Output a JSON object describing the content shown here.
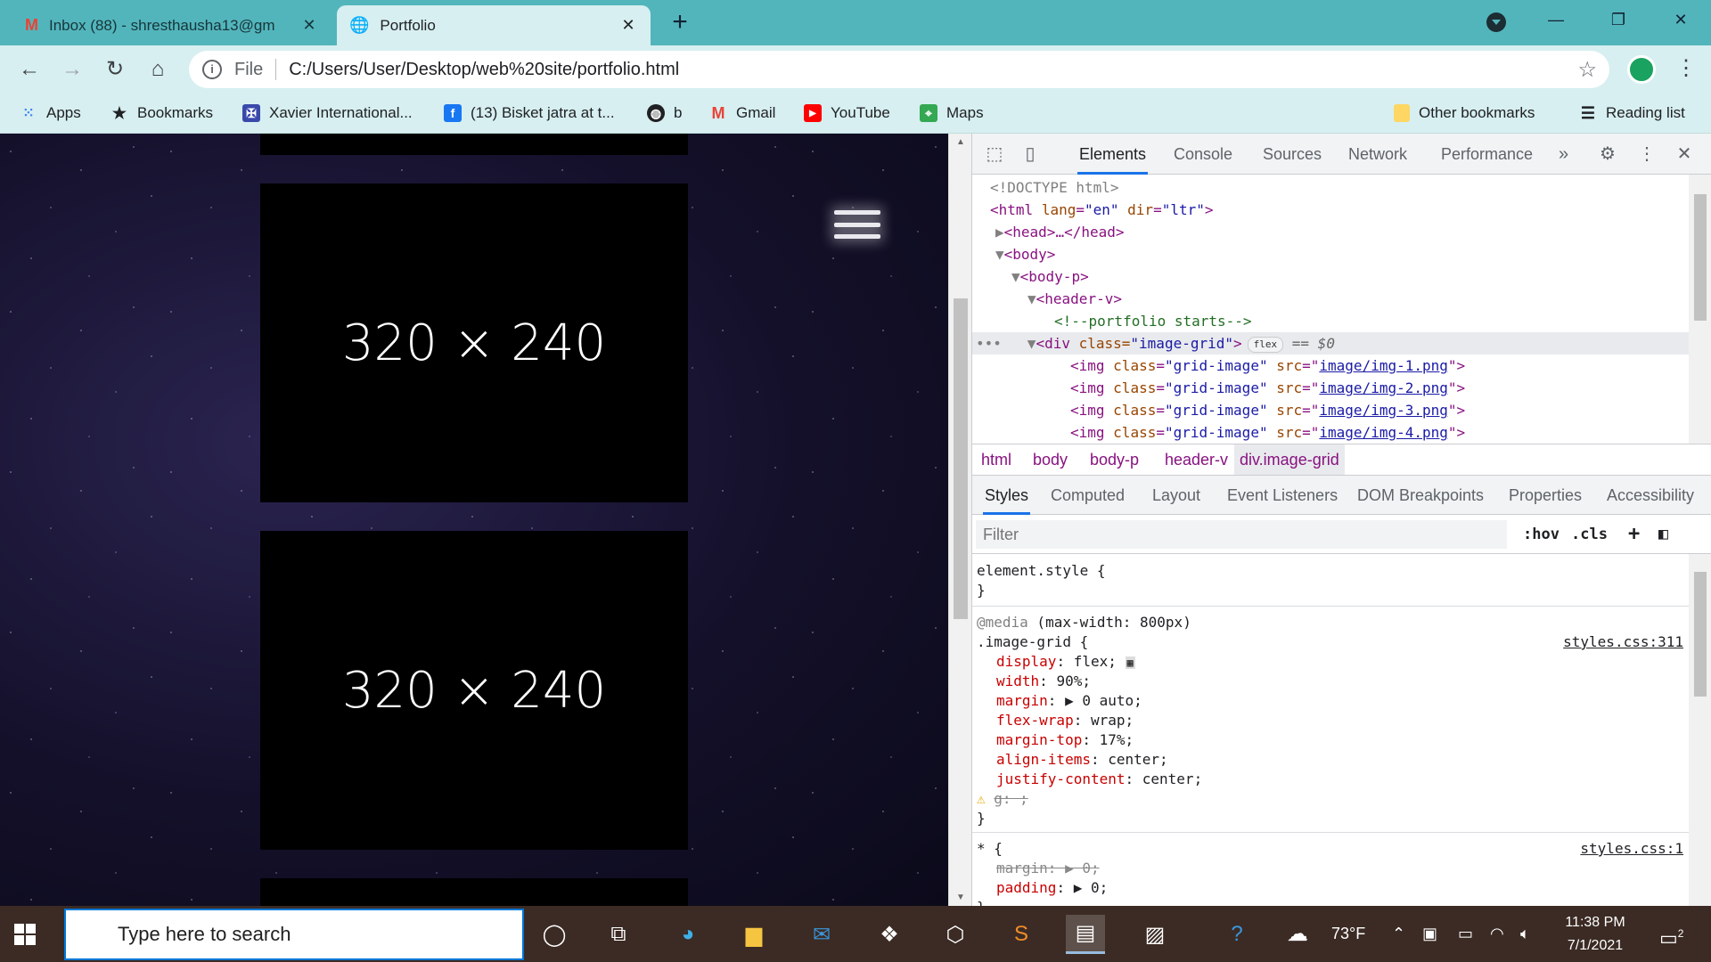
{
  "browser": {
    "tabs": [
      {
        "title": "Inbox (88) - shresthausha13@gm",
        "icon": "gmail-icon",
        "active": false
      },
      {
        "title": "Portfolio",
        "icon": "globe-icon",
        "active": true
      }
    ],
    "url_scheme": "File",
    "url": "C:/Users/User/Desktop/web%20site/portfolio.html"
  },
  "bookmarks": {
    "items": [
      {
        "label": "Apps",
        "icon": "apps-grid-icon"
      },
      {
        "label": "Bookmarks",
        "icon": "star-icon"
      },
      {
        "label": "Xavier International...",
        "icon": "shield-icon"
      },
      {
        "label": "(13) Bisket jatra at t...",
        "icon": "facebook-icon"
      },
      {
        "label": "b",
        "icon": "globe-icon"
      },
      {
        "label": "Gmail",
        "icon": "gmail-icon"
      },
      {
        "label": "YouTube",
        "icon": "youtube-icon"
      },
      {
        "label": "Maps",
        "icon": "maps-icon"
      }
    ],
    "other": "Other bookmarks",
    "reading_list": "Reading list"
  },
  "page": {
    "placeholders": [
      "320 × 240",
      "320 × 240"
    ]
  },
  "devtools": {
    "tabs": [
      "Elements",
      "Console",
      "Sources",
      "Network",
      "Performance"
    ],
    "active_tab": "Elements",
    "more": "»",
    "dom": {
      "doctype": "<!DOCTYPE html>",
      "html_open": "html",
      "html_attrs": [
        {
          "name": "lang",
          "value": "\"en\""
        },
        {
          "name": "dir",
          "value": "\"ltr\""
        }
      ],
      "head": "<head>…</head>",
      "body": "<body>",
      "body_p": "<body-p>",
      "header_v": "<header-v>",
      "comment": "<!--portfolio starts-->",
      "div_open": "<div ",
      "div_class_attr": "class=",
      "div_class_val": "\"image-grid\"",
      "div_close": ">",
      "flex_badge": "flex",
      "dollar": "== $0",
      "imgs": [
        "image/img-1.png",
        "image/img-2.png",
        "image/img-3.png",
        "image/img-4.png"
      ],
      "img_class": "\"grid-image\""
    },
    "breadcrumbs": [
      "html",
      "body",
      "body-p",
      "header-v",
      "div.image-grid"
    ],
    "style_tabs": [
      "Styles",
      "Computed",
      "Layout",
      "Event Listeners",
      "DOM Breakpoints",
      "Properties",
      "Accessibility"
    ],
    "filter_placeholder": "Filter",
    "hov": ":hov",
    "cls": ".cls",
    "plus": "+",
    "rules": {
      "element_style": "element.style {",
      "close": "}",
      "media": "@media",
      "media_cond": " (max-width: 800px)",
      "selector1": ".image-grid {",
      "source1": "styles.css:311",
      "decls": [
        {
          "prop": "display",
          "value": "flex;"
        },
        {
          "prop": "width",
          "value": "90%;"
        },
        {
          "prop": "margin",
          "value": "▶ 0 auto;"
        },
        {
          "prop": "flex-wrap",
          "value": "wrap;"
        },
        {
          "prop": "margin-top",
          "value": "17%;"
        },
        {
          "prop": "align-items",
          "value": "center;"
        },
        {
          "prop": "justify-content",
          "value": "center;"
        }
      ],
      "invalid": "g: ;",
      "selector2": "* {",
      "source2": "styles.css:1",
      "decls2": [
        {
          "prop": "margin",
          "value": "▶ 0;",
          "struck": true
        },
        {
          "prop": "padding",
          "value": "▶ 0;",
          "struck": false
        }
      ]
    }
  },
  "taskbar": {
    "search_placeholder": "Type here to search",
    "weather": "73°F",
    "time": "11:38 PM",
    "date": "7/1/2021",
    "notifications": "2"
  }
}
